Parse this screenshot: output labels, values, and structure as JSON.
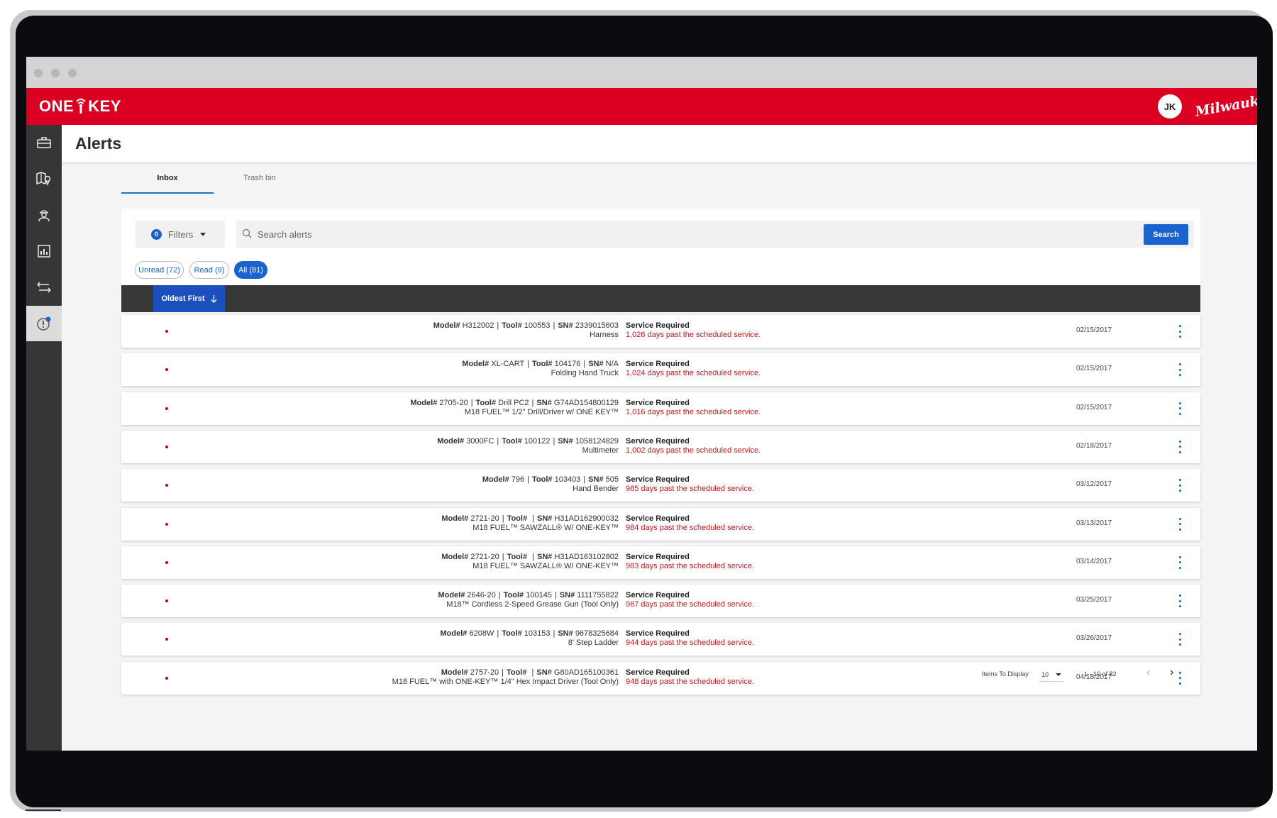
{
  "app": {
    "logo_left": "ONE",
    "logo_right": "KEY",
    "user_initials": "JK",
    "brand": "Milwaukee",
    "accent": "#db0021"
  },
  "nav": {
    "items": [
      "toolbox-icon",
      "map-location-icon",
      "worker-icon",
      "report-chart-icon",
      "transfer-arrows-icon",
      "alert-icon"
    ],
    "active": "alert-icon"
  },
  "page": {
    "title": "Alerts"
  },
  "tabs": [
    {
      "label": "Inbox",
      "active": true
    },
    {
      "label": "Trash bin",
      "active": false
    }
  ],
  "toolbar": {
    "filters_count": "0",
    "filters_label": "Filters",
    "search_placeholder": "Search alerts",
    "search_button": "Search"
  },
  "chips": [
    {
      "label": "Unread (72)",
      "selected": false
    },
    {
      "label": "Read (9)",
      "selected": false
    },
    {
      "label": "All (81)",
      "selected": true
    }
  ],
  "sort": {
    "label": "Oldest First"
  },
  "labels": {
    "model": "Model#",
    "tool": "Tool#",
    "sn": "SN#"
  },
  "alerts": [
    {
      "model": "H312002",
      "tool": "100553",
      "sn": "2339015603",
      "name": "Harness",
      "title": "Service Required",
      "detail": "1,026 days past the scheduled service.",
      "date": "02/15/2017"
    },
    {
      "model": "XL-CART",
      "tool": "104176",
      "sn": "N/A",
      "name": "Folding Hand Truck",
      "title": "Service Required",
      "detail": "1,024 days past the scheduled service.",
      "date": "02/15/2017"
    },
    {
      "model": "2705-20",
      "tool": "Drill PC2",
      "sn": "G74AD154800129",
      "name": "M18 FUEL™ 1/2\" Drill/Driver w/ ONE KEY™",
      "title": "Service Required",
      "detail": "1,016 days past the scheduled service.",
      "date": "02/15/2017"
    },
    {
      "model": "3000FC",
      "tool": "100122",
      "sn": "1058124829",
      "name": "Multimeter",
      "title": "Service Required",
      "detail": "1,002 days past the scheduled service.",
      "date": "02/18/2017"
    },
    {
      "model": "796",
      "tool": "103403",
      "sn": "505",
      "name": "Hand Bender",
      "title": "Service Required",
      "detail": "985 days past the scheduled service.",
      "date": "03/12/2017"
    },
    {
      "model": "2721-20",
      "tool": "",
      "sn": "H31AD162900032",
      "name": "M18 FUEL™ SAWZALL® W/ ONE-KEY™",
      "title": "Service Required",
      "detail": "984 days past the scheduled service.",
      "date": "03/13/2017"
    },
    {
      "model": "2721-20",
      "tool": "",
      "sn": "H31AD163102802",
      "name": "M18 FUEL™ SAWZALL® W/ ONE-KEY™",
      "title": "Service Required",
      "detail": "983 days past the scheduled service.",
      "date": "03/14/2017"
    },
    {
      "model": "2646-20",
      "tool": "100145",
      "sn": "1111755822",
      "name": "M18™ Cordless 2-Speed Grease Gun (Tool Only)",
      "title": "Service Required",
      "detail": "967 days past the scheduled service.",
      "date": "03/25/2017"
    },
    {
      "model": "6208W",
      "tool": "103153",
      "sn": "9678325684",
      "name": "8' Step Ladder",
      "title": "Service Required",
      "detail": "944 days past the scheduled service.",
      "date": "03/26/2017"
    },
    {
      "model": "2757-20",
      "tool": "",
      "sn": "G80AD165100361",
      "name": "M18 FUEL™ with ONE-KEY™ 1/4\" Hex Impact Driver (Tool Only)",
      "title": "Service Required",
      "detail": "948 days past the scheduled service.",
      "date": "04/18/2017"
    }
  ],
  "pager": {
    "items_label": "Items To Display",
    "items_value": "10",
    "range": "1 - 10 of 82"
  }
}
